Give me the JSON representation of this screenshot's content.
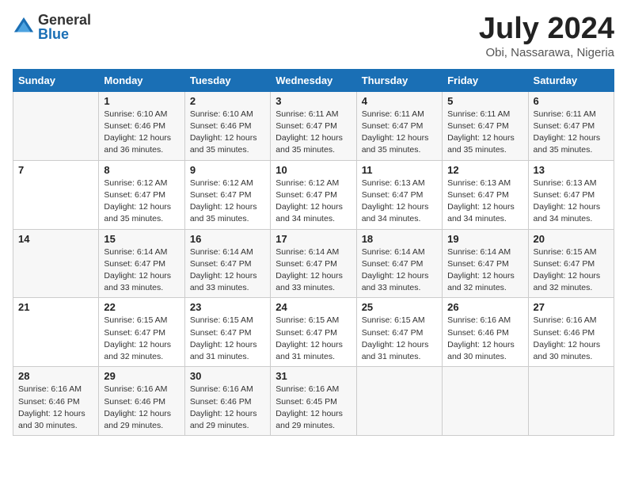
{
  "header": {
    "logo_general": "General",
    "logo_blue": "Blue",
    "month_year": "July 2024",
    "location": "Obi, Nassarawa, Nigeria"
  },
  "days_of_week": [
    "Sunday",
    "Monday",
    "Tuesday",
    "Wednesday",
    "Thursday",
    "Friday",
    "Saturday"
  ],
  "weeks": [
    [
      {
        "day": "",
        "info": ""
      },
      {
        "day": "1",
        "info": "Sunrise: 6:10 AM\nSunset: 6:46 PM\nDaylight: 12 hours and 36 minutes."
      },
      {
        "day": "2",
        "info": "Sunrise: 6:10 AM\nSunset: 6:46 PM\nDaylight: 12 hours and 35 minutes."
      },
      {
        "day": "3",
        "info": "Sunrise: 6:11 AM\nSunset: 6:47 PM\nDaylight: 12 hours and 35 minutes."
      },
      {
        "day": "4",
        "info": "Sunrise: 6:11 AM\nSunset: 6:47 PM\nDaylight: 12 hours and 35 minutes."
      },
      {
        "day": "5",
        "info": "Sunrise: 6:11 AM\nSunset: 6:47 PM\nDaylight: 12 hours and 35 minutes."
      },
      {
        "day": "6",
        "info": "Sunrise: 6:11 AM\nSunset: 6:47 PM\nDaylight: 12 hours and 35 minutes."
      }
    ],
    [
      {
        "day": "7",
        "info": ""
      },
      {
        "day": "8",
        "info": "Sunrise: 6:12 AM\nSunset: 6:47 PM\nDaylight: 12 hours and 35 minutes."
      },
      {
        "day": "9",
        "info": "Sunrise: 6:12 AM\nSunset: 6:47 PM\nDaylight: 12 hours and 35 minutes."
      },
      {
        "day": "10",
        "info": "Sunrise: 6:12 AM\nSunset: 6:47 PM\nDaylight: 12 hours and 34 minutes."
      },
      {
        "day": "11",
        "info": "Sunrise: 6:13 AM\nSunset: 6:47 PM\nDaylight: 12 hours and 34 minutes."
      },
      {
        "day": "12",
        "info": "Sunrise: 6:13 AM\nSunset: 6:47 PM\nDaylight: 12 hours and 34 minutes."
      },
      {
        "day": "13",
        "info": "Sunrise: 6:13 AM\nSunset: 6:47 PM\nDaylight: 12 hours and 34 minutes."
      }
    ],
    [
      {
        "day": "14",
        "info": ""
      },
      {
        "day": "15",
        "info": "Sunrise: 6:14 AM\nSunset: 6:47 PM\nDaylight: 12 hours and 33 minutes."
      },
      {
        "day": "16",
        "info": "Sunrise: 6:14 AM\nSunset: 6:47 PM\nDaylight: 12 hours and 33 minutes."
      },
      {
        "day": "17",
        "info": "Sunrise: 6:14 AM\nSunset: 6:47 PM\nDaylight: 12 hours and 33 minutes."
      },
      {
        "day": "18",
        "info": "Sunrise: 6:14 AM\nSunset: 6:47 PM\nDaylight: 12 hours and 33 minutes."
      },
      {
        "day": "19",
        "info": "Sunrise: 6:14 AM\nSunset: 6:47 PM\nDaylight: 12 hours and 32 minutes."
      },
      {
        "day": "20",
        "info": "Sunrise: 6:15 AM\nSunset: 6:47 PM\nDaylight: 12 hours and 32 minutes."
      }
    ],
    [
      {
        "day": "21",
        "info": ""
      },
      {
        "day": "22",
        "info": "Sunrise: 6:15 AM\nSunset: 6:47 PM\nDaylight: 12 hours and 32 minutes."
      },
      {
        "day": "23",
        "info": "Sunrise: 6:15 AM\nSunset: 6:47 PM\nDaylight: 12 hours and 31 minutes."
      },
      {
        "day": "24",
        "info": "Sunrise: 6:15 AM\nSunset: 6:47 PM\nDaylight: 12 hours and 31 minutes."
      },
      {
        "day": "25",
        "info": "Sunrise: 6:15 AM\nSunset: 6:47 PM\nDaylight: 12 hours and 31 minutes."
      },
      {
        "day": "26",
        "info": "Sunrise: 6:16 AM\nSunset: 6:46 PM\nDaylight: 12 hours and 30 minutes."
      },
      {
        "day": "27",
        "info": "Sunrise: 6:16 AM\nSunset: 6:46 PM\nDaylight: 12 hours and 30 minutes."
      }
    ],
    [
      {
        "day": "28",
        "info": "Sunrise: 6:16 AM\nSunset: 6:46 PM\nDaylight: 12 hours and 30 minutes."
      },
      {
        "day": "29",
        "info": "Sunrise: 6:16 AM\nSunset: 6:46 PM\nDaylight: 12 hours and 29 minutes."
      },
      {
        "day": "30",
        "info": "Sunrise: 6:16 AM\nSunset: 6:46 PM\nDaylight: 12 hours and 29 minutes."
      },
      {
        "day": "31",
        "info": "Sunrise: 6:16 AM\nSunset: 6:45 PM\nDaylight: 12 hours and 29 minutes."
      },
      {
        "day": "",
        "info": ""
      },
      {
        "day": "",
        "info": ""
      },
      {
        "day": "",
        "info": ""
      }
    ]
  ]
}
